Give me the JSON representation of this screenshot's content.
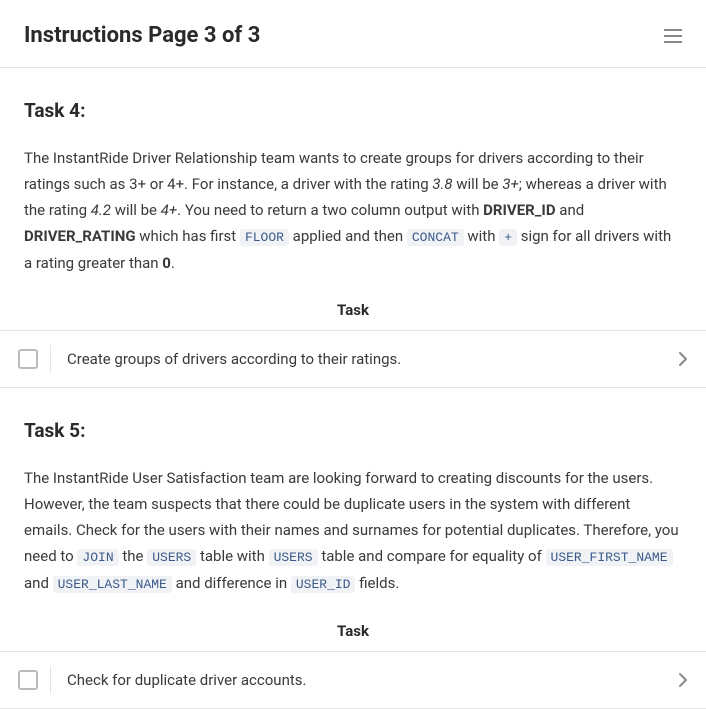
{
  "header": {
    "title": "Instructions Page 3 of 3"
  },
  "task_label": "Task",
  "task4": {
    "heading": "Task 4:",
    "p1a": "The InstantRide Driver Relationship team wants to create groups for drivers according to their ratings such as 3+ or 4+. For instance, a driver with the rating ",
    "em1": "3.8",
    "p1b": " will be ",
    "em2": "3+",
    "p1c": "; whereas a driver with the rating ",
    "em3": "4.2",
    "p1d": " will be ",
    "em4": "4+",
    "p1e": ". You need to return a two column output with ",
    "b1": "DRIVER_ID",
    "p1f": " and ",
    "b2": "DRIVER_RATING",
    "p1g": " which has first ",
    "c1": "FLOOR",
    "p1h": " applied and then ",
    "c2": "CONCAT",
    "p1i": " with ",
    "c3": "+",
    "p1j": " sign for all drivers with a rating greater than ",
    "b3": "0",
    "p1k": ".",
    "item": "Create groups of drivers according to their ratings."
  },
  "task5": {
    "heading": "Task 5:",
    "p1a": "The InstantRide User Satisfaction team are looking forward to creating discounts for the users. However, the team suspects that there could be duplicate users in the system with different emails. Check for the users with their names and surnames for potential duplicates. Therefore, you need to ",
    "c1": "JOIN",
    "p1b": " the ",
    "c2": "USERS",
    "p1c": " table with ",
    "c3": "USERS",
    "p1d": " table and compare for equality of ",
    "c4": "USER_FIRST_NAME",
    "p1e": " and ",
    "c5": "USER_LAST_NAME",
    "p1f": " and difference in ",
    "c6": "USER_ID",
    "p1g": " fields.",
    "item": "Check for duplicate driver accounts."
  }
}
